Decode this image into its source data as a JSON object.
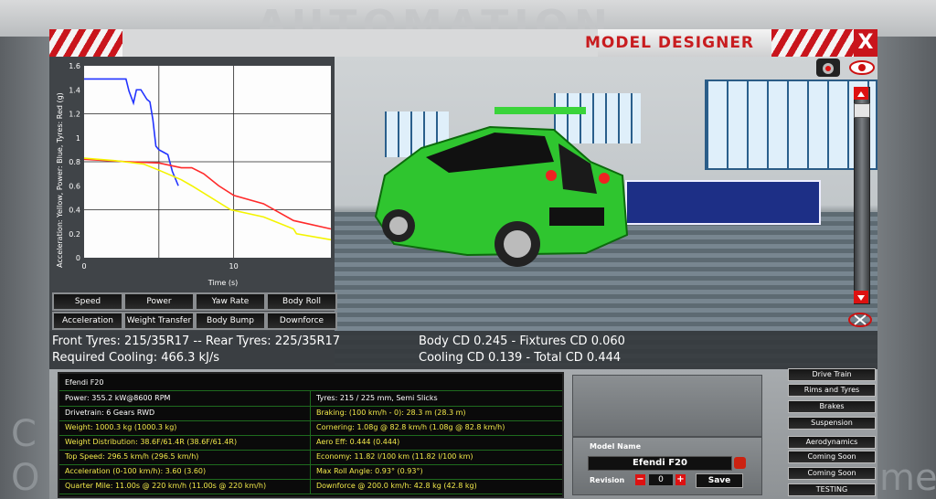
{
  "background": {
    "brand_text": "AUTOMATION",
    "ghost_left_1": "C",
    "ghost_left_2": "O",
    "ghost_right": "me"
  },
  "window": {
    "title": "MODEL DESIGNER",
    "close_label": "X"
  },
  "graph": {
    "ylabel": "Acceleration: Yellow, Power: Blue, Tyres: Red (g)",
    "xlabel": "Time (s)",
    "buttons": [
      "Speed",
      "Power",
      "Yaw Rate",
      "Body Roll",
      "Acceleration",
      "Weight Transfer",
      "Body Bump",
      "Downforce"
    ]
  },
  "chart_data": {
    "type": "line",
    "xlabel": "Time (s)",
    "ylabel": "Acceleration: Yellow, Power: Blue, Tyres: Red (g)",
    "xlim": [
      0,
      16.5
    ],
    "ylim": [
      0,
      1.6
    ],
    "yticks": [
      "0",
      "0.2",
      "0.4",
      "0.6",
      "0.8",
      "1",
      "1.2",
      "1.4",
      "1.6"
    ],
    "xticks": [
      "0",
      "10"
    ],
    "grid": true,
    "series": [
      {
        "color": "#2233ff",
        "x": [
          0,
          2.8,
          3.0,
          3.3,
          3.5,
          3.8,
          4.2,
          4.4,
          4.6,
          4.8,
          5.0,
          5.3,
          5.6,
          5.9,
          6.3
        ],
        "y": [
          1.49,
          1.49,
          1.39,
          1.29,
          1.4,
          1.4,
          1.32,
          1.3,
          1.15,
          0.93,
          0.9,
          0.88,
          0.86,
          0.72,
          0.6
        ]
      },
      {
        "color": "#ff2a2a",
        "x": [
          0,
          3,
          5,
          6.5,
          7.2,
          8,
          9,
          10,
          12,
          14,
          16.5
        ],
        "y": [
          0.82,
          0.8,
          0.79,
          0.75,
          0.75,
          0.7,
          0.6,
          0.52,
          0.45,
          0.31,
          0.24
        ]
      },
      {
        "color": "#f4f400",
        "x": [
          0,
          2,
          4,
          5,
          6.5,
          7.2,
          9.8,
          12,
          14,
          14.2,
          16.5
        ],
        "y": [
          0.83,
          0.81,
          0.78,
          0.73,
          0.65,
          0.6,
          0.4,
          0.34,
          0.24,
          0.2,
          0.15
        ]
      }
    ]
  },
  "info": {
    "tyres": "Front Tyres: 215/35R17 -- Rear Tyres: 225/35R17",
    "cooling": "Required Cooling: 466.3 kJ/s",
    "cd_1": "Body CD 0.245 - Fixtures CD 0.060",
    "cd_2": "Cooling CD 0.139 - Total CD 0.444"
  },
  "stats": {
    "name": "Efendi F20",
    "rows": [
      {
        "left": "Power: 355.2 kW@8600 RPM",
        "left_color": "w",
        "right": "Tyres: 215 / 225 mm, Semi Slicks",
        "right_color": "w"
      },
      {
        "left": "Drivetrain: 6 Gears RWD",
        "left_color": "w",
        "right": "Braking: (100 km/h - 0): 28.3 m (28.3 m)",
        "right_color": "y"
      },
      {
        "left": "Weight: 1000.3 kg (1000.3 kg)",
        "left_color": "y",
        "right": "Cornering: 1.08g @ 82.8 km/h (1.08g @ 82.8 km/h)",
        "right_color": "y"
      },
      {
        "left": "Weight Distribution: 38.6F/61.4R (38.6F/61.4R)",
        "left_color": "y",
        "right": "Aero Eff: 0.444 (0.444)",
        "right_color": "y"
      },
      {
        "left": "Top Speed: 296.5 km/h (296.5 km/h)",
        "left_color": "y",
        "right": "Economy: 11.82 l/100 km (11.82 l/100 km)",
        "right_color": "y"
      },
      {
        "left": "Acceleration (0-100 km/h): 3.60 (3.60)",
        "left_color": "y",
        "right": "Max Roll Angle: 0.93° (0.93°)",
        "right_color": "y"
      },
      {
        "left": "Quarter Mile: 11.00s @ 220 km/h (11.00s @ 220 km/h)",
        "left_color": "y",
        "right": "Downforce @ 200.0 km/h: 42.8 kg (42.8 kg)",
        "right_color": "y"
      }
    ]
  },
  "model": {
    "label": "Model Name",
    "name": "Efendi F20",
    "revision_label": "Revision",
    "revision": "0",
    "save_label": "Save"
  },
  "right_buttons": [
    "Drive Train",
    "Rims and Tyres",
    "Brakes",
    "Suspension",
    "Aerodynamics",
    "Coming Soon",
    "Coming Soon",
    "TESTING"
  ]
}
